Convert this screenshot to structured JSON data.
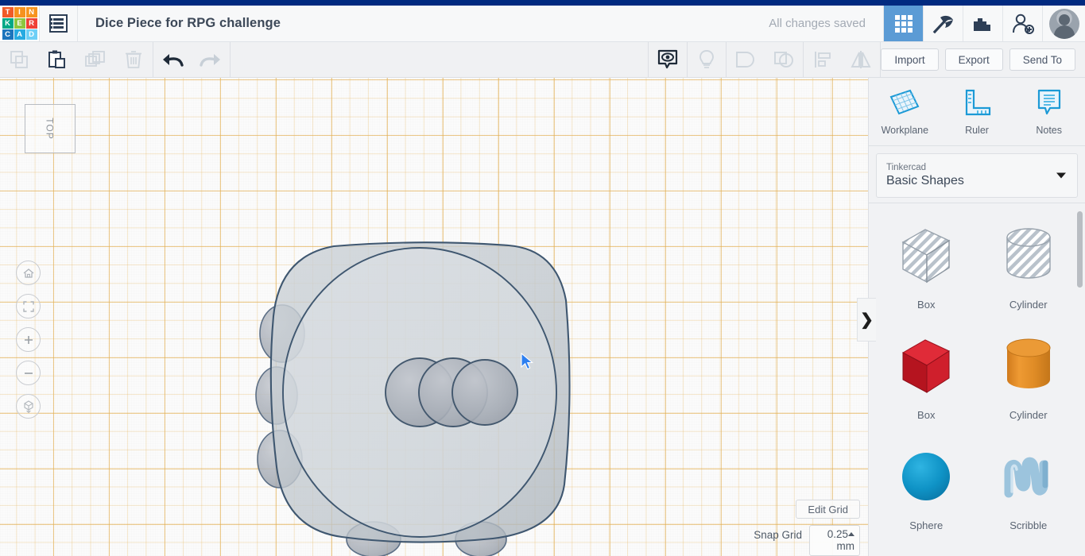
{
  "app": {
    "logo_letters": [
      {
        "ch": "T",
        "color": "#f05a28"
      },
      {
        "ch": "I",
        "color": "#f6921e"
      },
      {
        "ch": "N",
        "color": "#f7941e"
      },
      {
        "ch": "K",
        "color": "#00a887"
      },
      {
        "ch": "E",
        "color": "#8dc63f"
      },
      {
        "ch": "R",
        "color": "#ef4136"
      },
      {
        "ch": "C",
        "color": "#1c75bc"
      },
      {
        "ch": "A",
        "color": "#27aae1"
      },
      {
        "ch": "D",
        "color": "#6dcff6"
      }
    ],
    "accent_blue": "#012a80",
    "active_tab_color": "#5b9bd5"
  },
  "header": {
    "doc_menu_icon": "document-list-icon",
    "title": "Dice Piece for RPG challenge",
    "save_status": "All changes saved",
    "nav_icons": [
      {
        "name": "grid-view-icon",
        "active": true
      },
      {
        "name": "pickaxe-icon",
        "active": false
      },
      {
        "name": "blocks-icon",
        "active": false
      },
      {
        "name": "add-user-icon",
        "active": false
      }
    ],
    "avatar": "user-avatar"
  },
  "toolbar": {
    "left_tools": [
      {
        "name": "copy-icon",
        "label": "Copy",
        "enabled": false
      },
      {
        "name": "paste-icon",
        "label": "Paste",
        "enabled": true
      },
      {
        "name": "duplicate-icon",
        "label": "Duplicate",
        "enabled": false
      },
      {
        "name": "delete-icon",
        "label": "Delete",
        "enabled": false
      },
      {
        "name": "undo-icon",
        "label": "Undo",
        "enabled": true
      },
      {
        "name": "redo-icon",
        "label": "Redo",
        "enabled": false
      }
    ],
    "center_tools": [
      {
        "name": "show-hide-icon",
        "label": "Show/Hide",
        "enabled": true
      },
      {
        "name": "lightbulb-icon",
        "label": "Hint",
        "enabled": false
      },
      {
        "name": "group-icon",
        "label": "Group",
        "enabled": false
      },
      {
        "name": "ungroup-icon",
        "label": "Ungroup",
        "enabled": false
      },
      {
        "name": "align-icon",
        "label": "Align",
        "enabled": false
      },
      {
        "name": "mirror-icon",
        "label": "Mirror",
        "enabled": false
      }
    ],
    "import_label": "Import",
    "export_label": "Export",
    "send_to_label": "Send To"
  },
  "viewport": {
    "view_cube_label": "TOP",
    "nav_buttons": [
      {
        "name": "home-view-icon",
        "label": "Home view"
      },
      {
        "name": "fit-to-view-icon",
        "label": "Fit all in view"
      },
      {
        "name": "zoom-in-icon",
        "label": "Zoom in"
      },
      {
        "name": "zoom-out-icon",
        "label": "Zoom out"
      },
      {
        "name": "perspective-toggle-icon",
        "label": "Switch to orthographic view"
      }
    ],
    "edit_grid_label": "Edit Grid",
    "snap_grid_label": "Snap Grid",
    "snap_grid_value": "0.25",
    "snap_grid_unit": "mm",
    "grid_line_color": "#e1aa46",
    "collapse_handle": "❯"
  },
  "right_panel": {
    "tools": [
      {
        "name": "workplane-icon",
        "label": "Workplane"
      },
      {
        "name": "ruler-icon",
        "label": "Ruler"
      },
      {
        "name": "notes-icon",
        "label": "Notes"
      }
    ],
    "library_dropdown": {
      "group_label": "Tinkercad",
      "selected": "Basic Shapes"
    },
    "shapes": [
      {
        "label": "Box",
        "kind": "box-hole",
        "color": "#c3cbd4"
      },
      {
        "label": "Cylinder",
        "kind": "cylinder-hole",
        "color": "#c3cbd4"
      },
      {
        "label": "Box",
        "kind": "box-solid",
        "color": "#d11f2b"
      },
      {
        "label": "Cylinder",
        "kind": "cylinder-solid",
        "color": "#e8902b"
      },
      {
        "label": "Sphere",
        "kind": "sphere-solid",
        "color": "#1593c4"
      },
      {
        "label": "Scribble",
        "kind": "scribble-solid",
        "color": "#9cc4dd"
      }
    ]
  }
}
